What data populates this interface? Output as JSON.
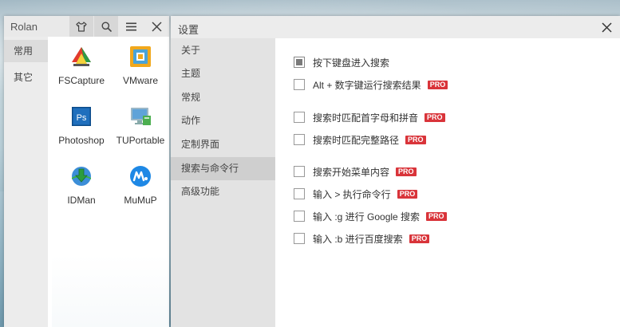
{
  "launcher": {
    "title": "Rolan",
    "icons": {
      "skin": "shirt-icon",
      "search": "search-icon",
      "menu": "menu-icon",
      "close": "close-icon"
    },
    "categories": [
      {
        "label": "常用",
        "active": true
      },
      {
        "label": "其它",
        "active": false
      }
    ],
    "apps": [
      {
        "label": "FSCapture",
        "icon": "fscapture-icon"
      },
      {
        "label": "VMware",
        "icon": "vmware-icon"
      },
      {
        "label": "Photoshop",
        "icon": "photoshop-icon",
        "glyph": "Ps"
      },
      {
        "label": "TUPortable",
        "icon": "tuportable-icon"
      },
      {
        "label": "IDMan",
        "icon": "idman-icon"
      },
      {
        "label": "MuMuP",
        "icon": "mumu-icon"
      }
    ]
  },
  "settings": {
    "title": "设置",
    "close_icon": "close-icon",
    "nav": [
      {
        "label": "关于",
        "active": false
      },
      {
        "label": "主题",
        "active": false
      },
      {
        "label": "常规",
        "active": false
      },
      {
        "label": "动作",
        "active": false
      },
      {
        "label": "定制界面",
        "active": false
      },
      {
        "label": "搜索与命令行",
        "active": true
      },
      {
        "label": "高级功能",
        "active": false
      }
    ],
    "pro_badge": "PRO",
    "options": [
      {
        "label": "按下键盘进入搜索",
        "checked": true,
        "pro": false
      },
      {
        "label": "Alt + 数字键运行搜索结果",
        "checked": false,
        "pro": true
      },
      {
        "label": "搜索时匹配首字母和拼音",
        "checked": false,
        "pro": true
      },
      {
        "label": "搜索时匹配完整路径",
        "checked": false,
        "pro": true
      },
      {
        "label": "搜索开始菜单内容",
        "checked": false,
        "pro": true
      },
      {
        "label": "输入 > 执行命令行",
        "checked": false,
        "pro": true
      },
      {
        "label": "输入 :g 进行 Google 搜索",
        "checked": false,
        "pro": true
      },
      {
        "label": "输入 :b 进行百度搜索",
        "checked": false,
        "pro": true
      }
    ]
  },
  "colors": {
    "pro_badge": "#d9343a",
    "nav_active": "#cfcfcf",
    "nav_bg": "#e3e3e3",
    "titlebar": "#ececec"
  }
}
